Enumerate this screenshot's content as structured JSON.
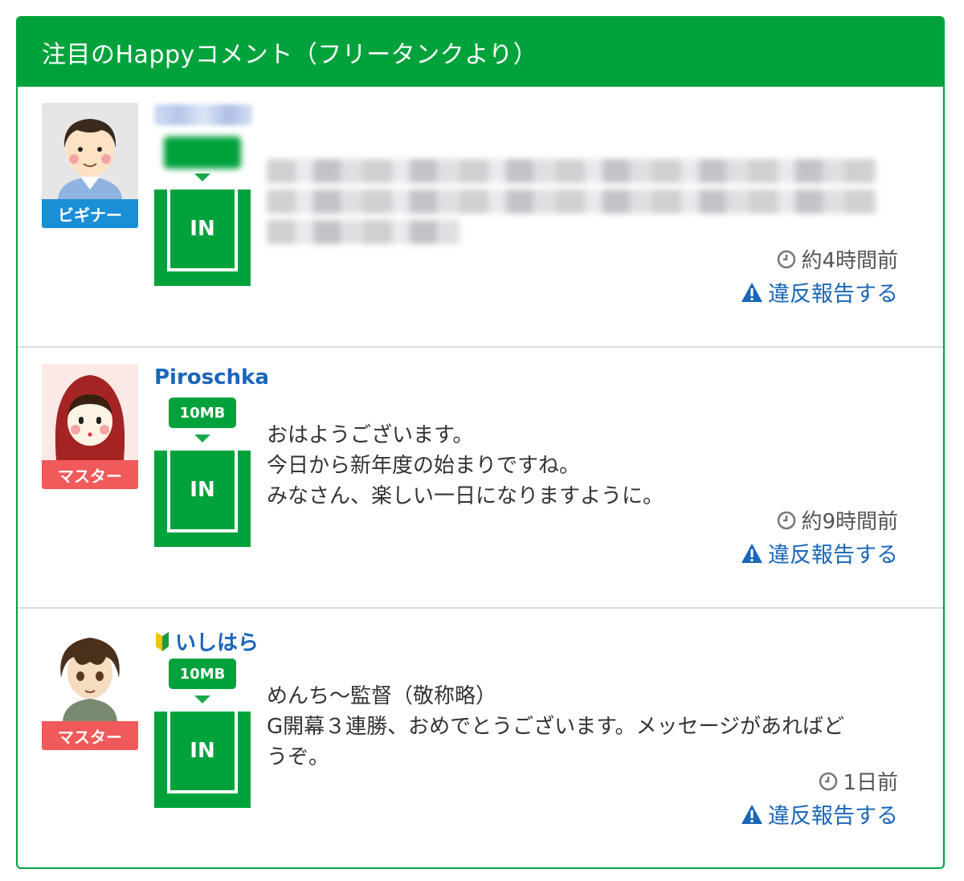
{
  "header": {
    "title": "注目のHappyコメント（フリータンクより）"
  },
  "colors": {
    "brand_green": "#00a23c",
    "link_blue": "#1a66b8",
    "beginner_badge": "#1a8fd6",
    "master_badge": "#f05a5a"
  },
  "comments": [
    {
      "username": "",
      "rank": "ビギナー",
      "size_tag": "",
      "in_label": "IN",
      "message": "",
      "time": "約4時間前",
      "report": "違反報告する"
    },
    {
      "username": "Piroschka",
      "rank": "マスター",
      "size_tag": "10MB",
      "in_label": "IN",
      "message": "おはようございます。\n今日から新年度の始まりですね。\nみなさん、楽しい一日になりますように。",
      "time": "約9時間前",
      "report": "違反報告する"
    },
    {
      "username": "いしはら",
      "rank": "マスター",
      "size_tag": "10MB",
      "in_label": "IN",
      "message": "めんち〜監督（敬称略）\nG開幕３連勝、おめでとうございます。メッセージがあればど\nうぞ。",
      "time": "1日前",
      "report": "違反報告する"
    }
  ]
}
